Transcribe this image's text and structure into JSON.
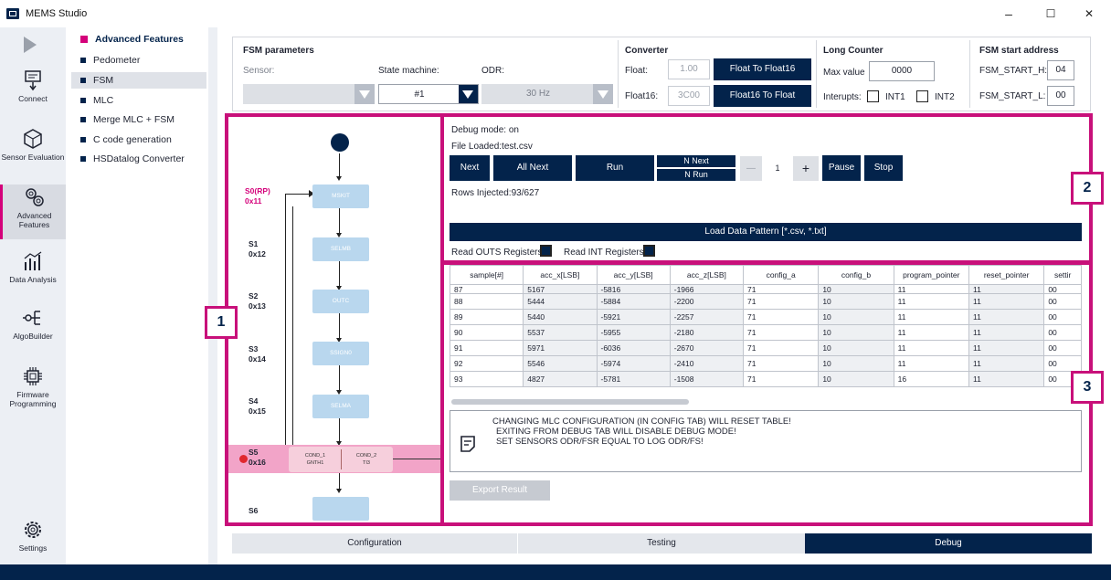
{
  "window": {
    "title": "MEMS Studio",
    "minimize": "–",
    "maximize": "☐",
    "close": "✕"
  },
  "leftnav": {
    "connect": "Connect",
    "sensor_eval": "Sensor Evaluation",
    "advanced": "Advanced Features",
    "data_analysis": "Data Analysis",
    "algobuilder": "AlgoBuilder",
    "firmware": "Firmware Programming",
    "settings": "Settings"
  },
  "submenu": {
    "header": "Advanced Features",
    "items": [
      "Pedometer",
      "FSM",
      "MLC",
      "Merge MLC + FSM",
      "C code generation",
      "HSDatalog Converter"
    ]
  },
  "fsm_params": {
    "title": "FSM parameters",
    "sensor_label": "Sensor:",
    "state_machine_label": "State machine:",
    "odr_label": "ODR:",
    "state_machine_value": "#1",
    "odr_value": "30 Hz"
  },
  "converter": {
    "title": "Converter",
    "float_label": "Float:",
    "float_value": "1.00",
    "float_btn": "Float To Float16",
    "float16_label": "Float16:",
    "float16_value": "3C00",
    "float16_btn": "Float16 To Float"
  },
  "long_counter": {
    "title": "Long Counter",
    "max_label": "Max value",
    "max_value": "0000",
    "interrupts_label": "Interupts:",
    "int1": "INT1",
    "int2": "INT2"
  },
  "fsm_start": {
    "title": "FSM start address",
    "h_label": "FSM_START_H:",
    "h_value": "04",
    "l_label": "FSM_START_L:",
    "l_value": "00"
  },
  "diagram": {
    "states": [
      {
        "label": "S0(RP)",
        "addr": "0x11",
        "node": "MSKIT"
      },
      {
        "label": "S1",
        "addr": "0x12",
        "node": "SELMB"
      },
      {
        "label": "S2",
        "addr": "0x13",
        "node": "OUTC"
      },
      {
        "label": "S3",
        "addr": "0x14",
        "node": "SSIGN0"
      },
      {
        "label": "S4",
        "addr": "0x15",
        "node": "SELMA"
      },
      {
        "label": "S5",
        "addr": "0x16",
        "node": ""
      },
      {
        "label": "S6",
        "addr": "",
        "node": ""
      }
    ],
    "cond1": "COND_1",
    "cond1_val": "GNTH1",
    "cond2": "COND_2",
    "cond2_val": "TI3"
  },
  "debug": {
    "mode": "Debug mode: on",
    "file": "File Loaded:test.csv",
    "next": "Next",
    "all_next": "All Next",
    "run": "Run",
    "n_next": "N Next",
    "n_run": "N Run",
    "minus": "—",
    "count": "1",
    "plus": "+",
    "pause": "Pause",
    "stop": "Stop",
    "rows": "Rows Injected:93/627",
    "load": "Load Data Pattern [*.csv, *.txt]",
    "read_outs": "Read OUTS Registers",
    "read_int": "Read INT Registers"
  },
  "table": {
    "columns": [
      "sample[#]",
      "acc_x[LSB]",
      "acc_y[LSB]",
      "acc_z[LSB]",
      "config_a",
      "config_b",
      "program_pointer",
      "reset_pointer",
      "settir"
    ],
    "rows": [
      [
        "87",
        "5167",
        "-5816",
        "-1966",
        "71",
        "10",
        "11",
        "11",
        "00"
      ],
      [
        "88",
        "5444",
        "-5884",
        "-2200",
        "71",
        "10",
        "11",
        "11",
        "00"
      ],
      [
        "89",
        "5440",
        "-5921",
        "-2257",
        "71",
        "10",
        "11",
        "11",
        "00"
      ],
      [
        "90",
        "5537",
        "-5955",
        "-2180",
        "71",
        "10",
        "11",
        "11",
        "00"
      ],
      [
        "91",
        "5971",
        "-6036",
        "-2670",
        "71",
        "10",
        "11",
        "11",
        "00"
      ],
      [
        "92",
        "5546",
        "-5974",
        "-2410",
        "71",
        "10",
        "11",
        "11",
        "00"
      ],
      [
        "93",
        "4827",
        "-5781",
        "-1508",
        "71",
        "10",
        "16",
        "11",
        "00"
      ]
    ]
  },
  "warning": {
    "line1": "CHANGING MLC CONFIGURATION (IN CONFIG TAB) WILL RESET TABLE!",
    "line2": "EXITING FROM DEBUG TAB WILL DISABLE DEBUG MODE!",
    "line3": "SET SENSORS ODR/FSR EQUAL TO LOG ODR/FS!"
  },
  "export": "Export Result",
  "tabs": [
    "Configuration",
    "Testing",
    "Debug"
  ],
  "badges": [
    "1",
    "2",
    "3"
  ],
  "colors": {
    "navy": "#03234b",
    "magenta": "#d4007a",
    "annotation": "#c8107a",
    "node": "#b9d7ee"
  }
}
